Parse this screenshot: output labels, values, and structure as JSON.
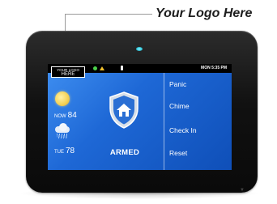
{
  "callout": {
    "text": "Your Logo Here"
  },
  "screen": {
    "status_bar": {
      "logo_line1": "YOUR LOGO",
      "logo_line2": "HERE",
      "time": "MON 5:35 PM"
    },
    "weather": {
      "now_label": "NOW",
      "now_temp": "84",
      "tue_label": "TUE",
      "tue_temp": "78"
    },
    "system_status": "ARMED",
    "menu": [
      {
        "label": "Panic"
      },
      {
        "label": "Chime"
      },
      {
        "label": "Check In"
      },
      {
        "label": "Reset"
      }
    ]
  },
  "colors": {
    "screen_blue": "#1e68d6",
    "led": "#2ec4d9",
    "sun": "#f5d35a"
  },
  "icons": [
    "sun-icon",
    "rain-cloud-icon",
    "house-shield-icon",
    "status-dot-icon",
    "warning-icon",
    "battery-icon",
    "led-indicator"
  ]
}
